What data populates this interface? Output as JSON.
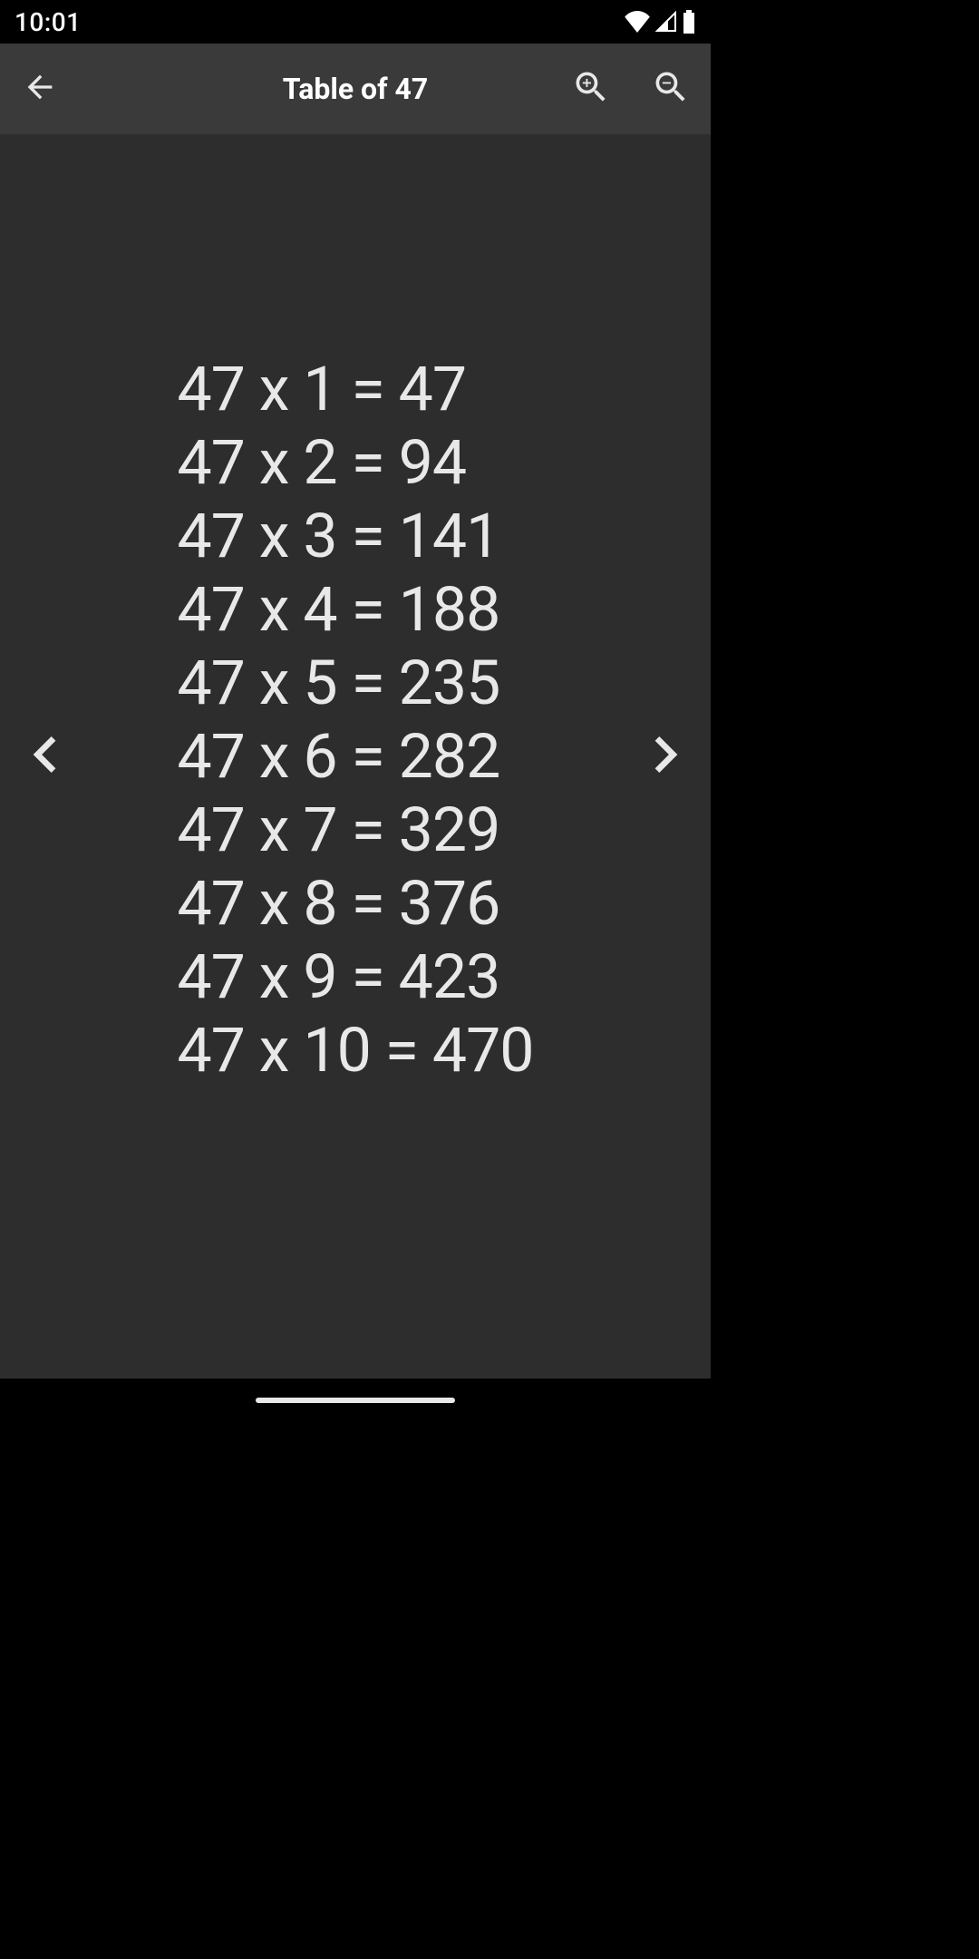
{
  "status": {
    "time": "10:01"
  },
  "appbar": {
    "title": "Table of 47"
  },
  "table": {
    "rows": [
      "47 x 1 = 47",
      "47 x 2 = 94",
      "47 x 3 = 141",
      "47 x 4 = 188",
      "47 x 5 = 235",
      "47 x 6 = 282",
      "47 x 7 = 329",
      "47 x 8 = 376",
      "47 x 9 = 423",
      "47 x 10 = 470"
    ]
  }
}
